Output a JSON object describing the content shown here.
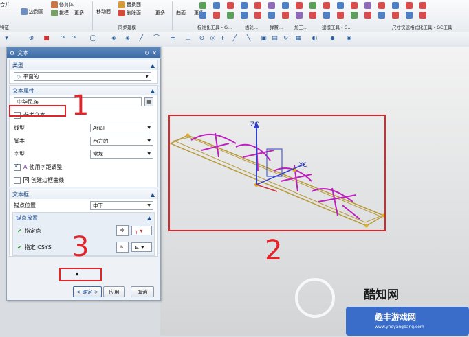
{
  "ribbon": {
    "buttons": [
      "合并",
      "边倒圆",
      "修剪体",
      "拔模",
      "更多",
      "移动面",
      "替换面",
      "删除面",
      "更多",
      "曲面",
      "更多"
    ],
    "groups": [
      "特征",
      "同步建模",
      "标准化工具 - G...",
      "齿轮...",
      "弹簧...",
      "加工...",
      "建模工具 - G...",
      "尺寸快速格式化工具 - GC工具"
    ]
  },
  "dialog": {
    "title": "文本",
    "sections": {
      "type": {
        "header": "类型",
        "value": "平面的"
      },
      "text_props": {
        "header": "文本属性",
        "text_value": "中华民族",
        "ref_text_label": "参考文本",
        "line_type_label": "线型",
        "line_type_value": "Arial",
        "script_label": "脚本",
        "script_value": "西方的",
        "style_label": "字型",
        "style_value": "常规",
        "kerning_label": "使用字距调整",
        "boundary_label": "创建边框曲线"
      },
      "text_frame": {
        "header": "文本框",
        "anchor_pos_label": "锚点位置",
        "anchor_pos_value": "中下",
        "anchor_place_header": "锚点放置",
        "point_label": "指定点",
        "csys_label": "指定 CSYS"
      }
    },
    "ok": "< 确定 >",
    "apply": "应用",
    "cancel": "取消"
  },
  "annotations": [
    "1",
    "2",
    "3"
  ],
  "watermark": {
    "brand": "酷知网",
    "site_cn": "趣丰游戏网",
    "url": "www.yneyangbang.com"
  },
  "viewport_labels": {
    "zc": "ZC",
    "yc": "YC"
  },
  "colors": {
    "annotation": "#e0242a",
    "text_curve": "#c020c0",
    "frame": "#b89a3a"
  }
}
